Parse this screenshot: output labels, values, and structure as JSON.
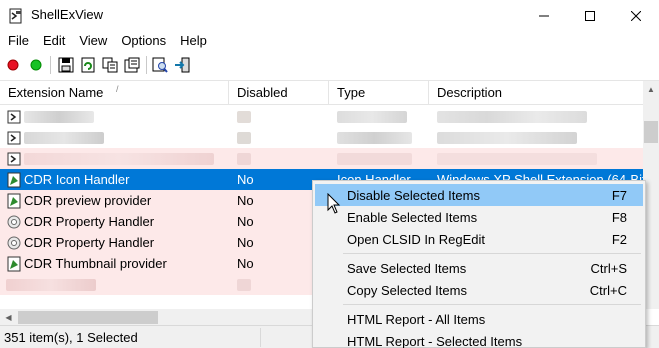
{
  "window": {
    "title": "ShellExView",
    "minimize_icon": "minimize-icon",
    "maximize_icon": "maximize-icon",
    "close_icon": "close-icon"
  },
  "menu": [
    "File",
    "Edit",
    "View",
    "Options",
    "Help"
  ],
  "toolbar": {
    "buttons": [
      "red-dot-icon",
      "green-dot-icon",
      "save-icon",
      "refresh-icon",
      "copy-icon",
      "properties-icon",
      "find-icon",
      "exit-icon"
    ]
  },
  "columns": {
    "extension_name": "Extension Name",
    "disabled": "Disabled",
    "type": "Type",
    "description": "Description",
    "sort_indicator": "/"
  },
  "rows": [
    {
      "name": "",
      "disabled": "",
      "type": "",
      "description": "",
      "state": "blurred"
    },
    {
      "name": "",
      "disabled": "",
      "type": "",
      "description": "",
      "state": "blurred"
    },
    {
      "name": "",
      "disabled": "",
      "type": "",
      "description": "",
      "state": "blurred-pink"
    },
    {
      "name": "CDR Icon Handler",
      "disabled": "No",
      "type": "Icon Handler",
      "description": "Windows XP Shell Extension (64-Bit",
      "state": "selected",
      "icon": "cdr-green-icon"
    },
    {
      "name": "CDR preview provider",
      "disabled": "No",
      "type": "",
      "description": "",
      "state": "pink",
      "icon": "cdr-green-icon"
    },
    {
      "name": "CDR Property Handler",
      "disabled": "No",
      "type": "",
      "description": "",
      "state": "pink",
      "icon": "gear-handler-icon"
    },
    {
      "name": "CDR Property Handler",
      "disabled": "No",
      "type": "",
      "description": "",
      "state": "pink",
      "icon": "gear-handler-icon"
    },
    {
      "name": "CDR Thumbnail provider",
      "disabled": "No",
      "type": "",
      "description": "",
      "state": "pink",
      "icon": "cdr-green-icon"
    },
    {
      "name": "",
      "disabled": "",
      "type": "",
      "description": "",
      "state": "blurred-pink"
    }
  ],
  "status": {
    "text": "351 item(s), 1 Selected"
  },
  "context_menu": {
    "items": [
      {
        "label": "Disable Selected Items",
        "shortcut": "F7",
        "hover": true
      },
      {
        "label": "Enable Selected Items",
        "shortcut": "F8"
      },
      {
        "label": "Open CLSID In RegEdit",
        "shortcut": "F2"
      },
      {
        "label": "Save Selected Items",
        "shortcut": "Ctrl+S"
      },
      {
        "label": "Copy Selected Items",
        "shortcut": "Ctrl+C"
      },
      {
        "label": "HTML Report - All Items",
        "shortcut": ""
      },
      {
        "label": "HTML Report - Selected Items",
        "shortcut": ""
      }
    ]
  },
  "colors": {
    "selection": "#0078d7",
    "pink_row": "#fde9e9",
    "menu_hover": "#91c9f7"
  }
}
